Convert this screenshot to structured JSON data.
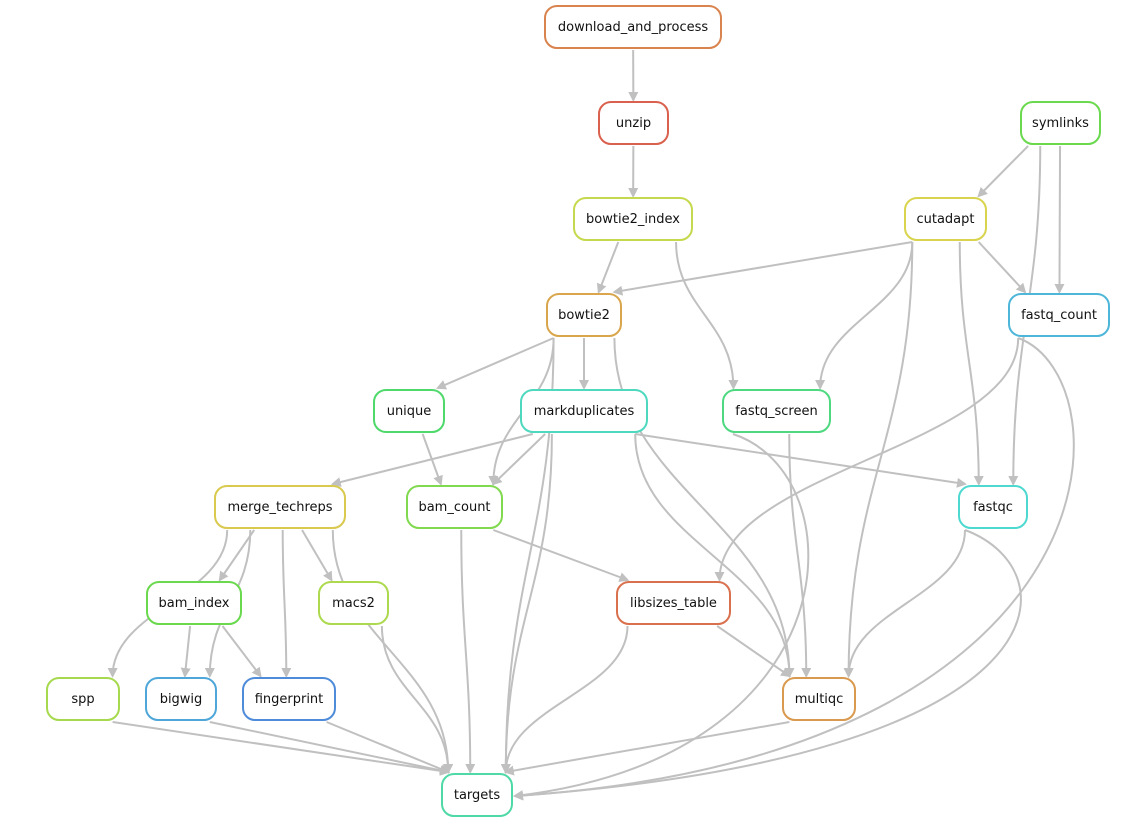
{
  "edge_color": "#c0c0c0",
  "nodes": [
    {
      "id": "download_and_process",
      "label": "download_and_process",
      "color": "#d9834e"
    },
    {
      "id": "unzip",
      "label": "unzip",
      "color": "#d9614e"
    },
    {
      "id": "bowtie2_index",
      "label": "bowtie2_index",
      "color": "#c6d94e"
    },
    {
      "id": "symlinks",
      "label": "symlinks",
      "color": "#6ad94e"
    },
    {
      "id": "cutadapt",
      "label": "cutadapt",
      "color": "#d9d44e"
    },
    {
      "id": "bowtie2",
      "label": "bowtie2",
      "color": "#d9a64e"
    },
    {
      "id": "fastq_count",
      "label": "fastq_count",
      "color": "#4eb6d9"
    },
    {
      "id": "unique",
      "label": "unique",
      "color": "#4ed96a"
    },
    {
      "id": "markduplicates",
      "label": "markduplicates",
      "color": "#4ed9bf"
    },
    {
      "id": "fastq_screen",
      "label": "fastq_screen",
      "color": "#4ed980"
    },
    {
      "id": "merge_techreps",
      "label": "merge_techreps",
      "color": "#d9c94e"
    },
    {
      "id": "bam_count",
      "label": "bam_count",
      "color": "#80d94e"
    },
    {
      "id": "fastqc",
      "label": "fastqc",
      "color": "#4ed9d0"
    },
    {
      "id": "bam_index",
      "label": "bam_index",
      "color": "#6ad94e"
    },
    {
      "id": "macs2",
      "label": "macs2",
      "color": "#acd94e"
    },
    {
      "id": "libsizes_table",
      "label": "libsizes_table",
      "color": "#d9704e"
    },
    {
      "id": "spp",
      "label": "spp",
      "color": "#a6d94e"
    },
    {
      "id": "bigwig",
      "label": "bigwig",
      "color": "#4ea6d9"
    },
    {
      "id": "fingerprint",
      "label": "fingerprint",
      "color": "#4e8cd9"
    },
    {
      "id": "multiqc",
      "label": "multiqc",
      "color": "#d9994e"
    },
    {
      "id": "targets",
      "label": "targets",
      "color": "#4ed9a6"
    }
  ],
  "edges": [
    [
      "download_and_process",
      "unzip"
    ],
    [
      "unzip",
      "bowtie2_index"
    ],
    [
      "bowtie2_index",
      "bowtie2"
    ],
    [
      "bowtie2_index",
      "fastq_screen"
    ],
    [
      "symlinks",
      "cutadapt"
    ],
    [
      "symlinks",
      "fastq_count"
    ],
    [
      "symlinks",
      "fastqc"
    ],
    [
      "cutadapt",
      "bowtie2"
    ],
    [
      "cutadapt",
      "fastq_count"
    ],
    [
      "cutadapt",
      "fastq_screen"
    ],
    [
      "cutadapt",
      "fastqc"
    ],
    [
      "cutadapt",
      "multiqc"
    ],
    [
      "bowtie2",
      "unique"
    ],
    [
      "bowtie2",
      "markduplicates"
    ],
    [
      "bowtie2",
      "bam_count"
    ],
    [
      "bowtie2",
      "multiqc"
    ],
    [
      "bowtie2",
      "targets"
    ],
    [
      "fastq_count",
      "libsizes_table"
    ],
    [
      "fastq_count",
      "targets"
    ],
    [
      "unique",
      "bam_count"
    ],
    [
      "markduplicates",
      "merge_techreps"
    ],
    [
      "markduplicates",
      "bam_count"
    ],
    [
      "markduplicates",
      "fastqc"
    ],
    [
      "markduplicates",
      "multiqc"
    ],
    [
      "markduplicates",
      "targets"
    ],
    [
      "fastq_screen",
      "multiqc"
    ],
    [
      "fastq_screen",
      "targets"
    ],
    [
      "merge_techreps",
      "bam_index"
    ],
    [
      "merge_techreps",
      "macs2"
    ],
    [
      "merge_techreps",
      "fingerprint"
    ],
    [
      "merge_techreps",
      "spp"
    ],
    [
      "merge_techreps",
      "bigwig"
    ],
    [
      "merge_techreps",
      "targets"
    ],
    [
      "bam_count",
      "libsizes_table"
    ],
    [
      "bam_count",
      "targets"
    ],
    [
      "fastqc",
      "multiqc"
    ],
    [
      "fastqc",
      "targets"
    ],
    [
      "bam_index",
      "bigwig"
    ],
    [
      "bam_index",
      "fingerprint"
    ],
    [
      "macs2",
      "targets"
    ],
    [
      "libsizes_table",
      "multiqc"
    ],
    [
      "libsizes_table",
      "targets"
    ],
    [
      "spp",
      "targets"
    ],
    [
      "bigwig",
      "targets"
    ],
    [
      "fingerprint",
      "targets"
    ],
    [
      "multiqc",
      "targets"
    ]
  ]
}
